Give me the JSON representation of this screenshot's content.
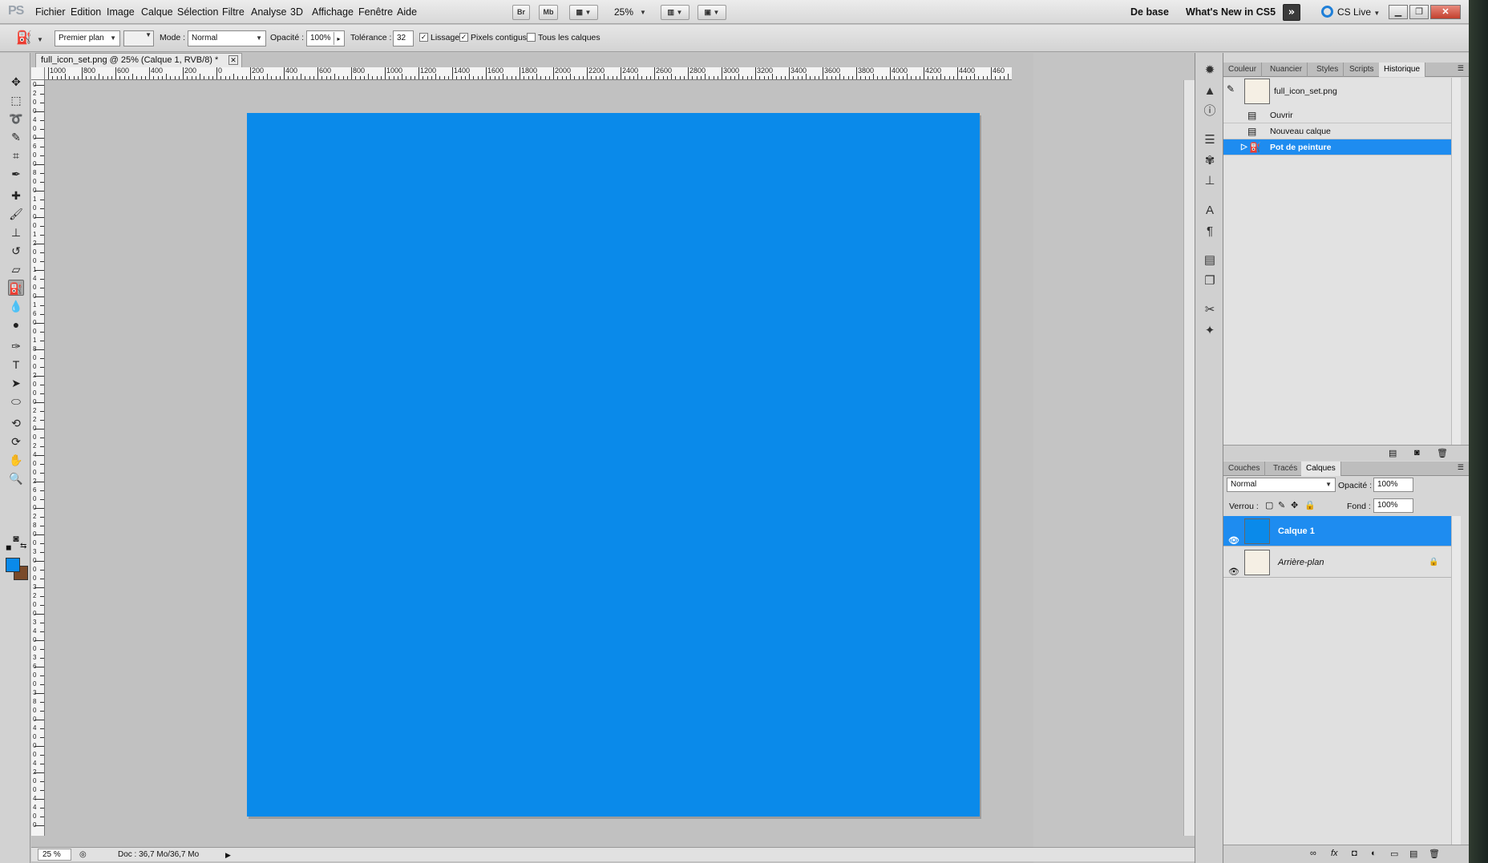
{
  "menubar": {
    "logo": "PS",
    "menus": [
      "Fichier",
      "Edition",
      "Image",
      "Calque",
      "Sélection",
      "Filtre",
      "Analyse",
      "3D",
      "Affichage",
      "Fenêtre",
      "Aide"
    ],
    "bridge_button": "Br",
    "minibridge_button": "Mb",
    "zoom": "25%",
    "workspace_basic": "De base",
    "workspace_whats_new": "What's New in CS5",
    "cs_live": "CS Live"
  },
  "options": {
    "fill_source": "Premier plan",
    "mode_label": "Mode :",
    "mode_value": "Normal",
    "opacity_label": "Opacité :",
    "opacity_value": "100%",
    "tolerance_label": "Tolérance :",
    "tolerance_value": "32",
    "antialias_label": "Lissage",
    "antialias_checked": "✓",
    "contiguous_label": "Pixels contigus",
    "contiguous_checked": "✓",
    "all_layers_label": "Tous les calques"
  },
  "document": {
    "tab_title": "full_icon_set.png @ 25% (Calque 1, RVB/8) *",
    "canvas_color": "#0a8aea",
    "ruler_h_labels": [
      "1000",
      "800",
      "600",
      "400",
      "200",
      "0",
      "200",
      "400",
      "600",
      "800",
      "1000",
      "1200",
      "1400",
      "1600",
      "1800",
      "2000",
      "2200",
      "2400",
      "2600",
      "2800",
      "3000",
      "3200",
      "3400",
      "3600",
      "3800",
      "4000",
      "4200",
      "4400",
      "460"
    ],
    "ruler_v_labels": [
      "0",
      "2",
      "0",
      "0",
      "4",
      "0",
      "0",
      "6",
      "0",
      "0",
      "8",
      "0",
      "0",
      "1",
      "0",
      "0",
      "0",
      "1",
      "2",
      "0",
      "0",
      "1",
      "4",
      "0",
      "0",
      "1",
      "6",
      "0",
      "0",
      "1",
      "8",
      "0",
      "0",
      "2",
      "0",
      "0",
      "0",
      "2",
      "2",
      "0",
      "0",
      "2",
      "4",
      "0",
      "0",
      "2",
      "6",
      "0",
      "0",
      "2",
      "8",
      "0",
      "0",
      "3",
      "0",
      "0",
      "0",
      "3",
      "2",
      "0",
      "0",
      "3",
      "4",
      "0",
      "0",
      "3",
      "6",
      "0",
      "0",
      "3",
      "8",
      "0",
      "0",
      "4",
      "0",
      "0",
      "0",
      "4",
      "2",
      "0",
      "0",
      "4",
      "4",
      "0",
      "0"
    ],
    "status_zoom": "25 %",
    "status_doc": "Doc : 36,7 Mo/36,7 Mo"
  },
  "history_panel": {
    "tabs": [
      "Couleur",
      "Nuancier",
      "Styles",
      "Scripts",
      "Historique"
    ],
    "snapshot": "full_icon_set.png",
    "steps": [
      "Ouvrir",
      "Nouveau calque",
      "Pot de peinture"
    ]
  },
  "layers_panel": {
    "tabs": [
      "Couches",
      "Tracés",
      "Calques"
    ],
    "blend_mode": "Normal",
    "opacity_label": "Opacité :",
    "opacity_value": "100%",
    "lock_label": "Verrou :",
    "fill_label": "Fond :",
    "fill_value": "100%",
    "layers": [
      {
        "name": "Calque 1",
        "selected": true
      },
      {
        "name": "Arrière-plan",
        "selected": false
      }
    ]
  },
  "tools": [
    "move-tool",
    "marquee-tool",
    "lasso-tool",
    "quick-selection-tool",
    "crop-tool",
    "eyedropper-tool",
    "healing-brush-tool",
    "brush-tool",
    "clone-stamp-tool",
    "history-brush-tool",
    "eraser-tool",
    "paint-bucket-tool",
    "blur-tool",
    "dodge-tool",
    "pen-tool",
    "type-tool",
    "path-selection-tool",
    "ellipse-tool",
    "3d-rotate-tool",
    "3d-orbit-tool",
    "hand-tool",
    "zoom-tool"
  ],
  "colors": {
    "foreground": "#0a8aea",
    "background": "#7a4a2a",
    "selection": "#1e8cf0"
  }
}
